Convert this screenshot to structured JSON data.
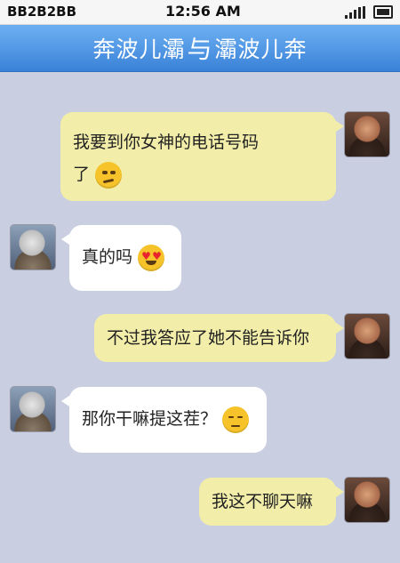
{
  "status_bar": {
    "carrier": "BB2B2BB",
    "time": "12:56 AM"
  },
  "header": {
    "title_left": "奔波儿灞",
    "title_mid": "与",
    "title_right": "灞波儿奔"
  },
  "messages": [
    {
      "side": "right",
      "line1": "我要到你女神的电话号码",
      "line2": "了",
      "emoji": "smirk-emoji"
    },
    {
      "side": "left",
      "text": "真的吗",
      "emoji": "heart-eyes-emoji"
    },
    {
      "side": "right",
      "text": "不过我答应了她不能告诉你"
    },
    {
      "side": "left",
      "text": "那你干嘛提这茬？",
      "emoji": "unamused-emoji"
    },
    {
      "side": "right",
      "text": "我这不聊天嘛"
    }
  ],
  "colors": {
    "title_bar": "#3a82d8",
    "background": "#c9cee1",
    "right_bubble": "#f2eeaa",
    "left_bubble": "#ffffff"
  }
}
